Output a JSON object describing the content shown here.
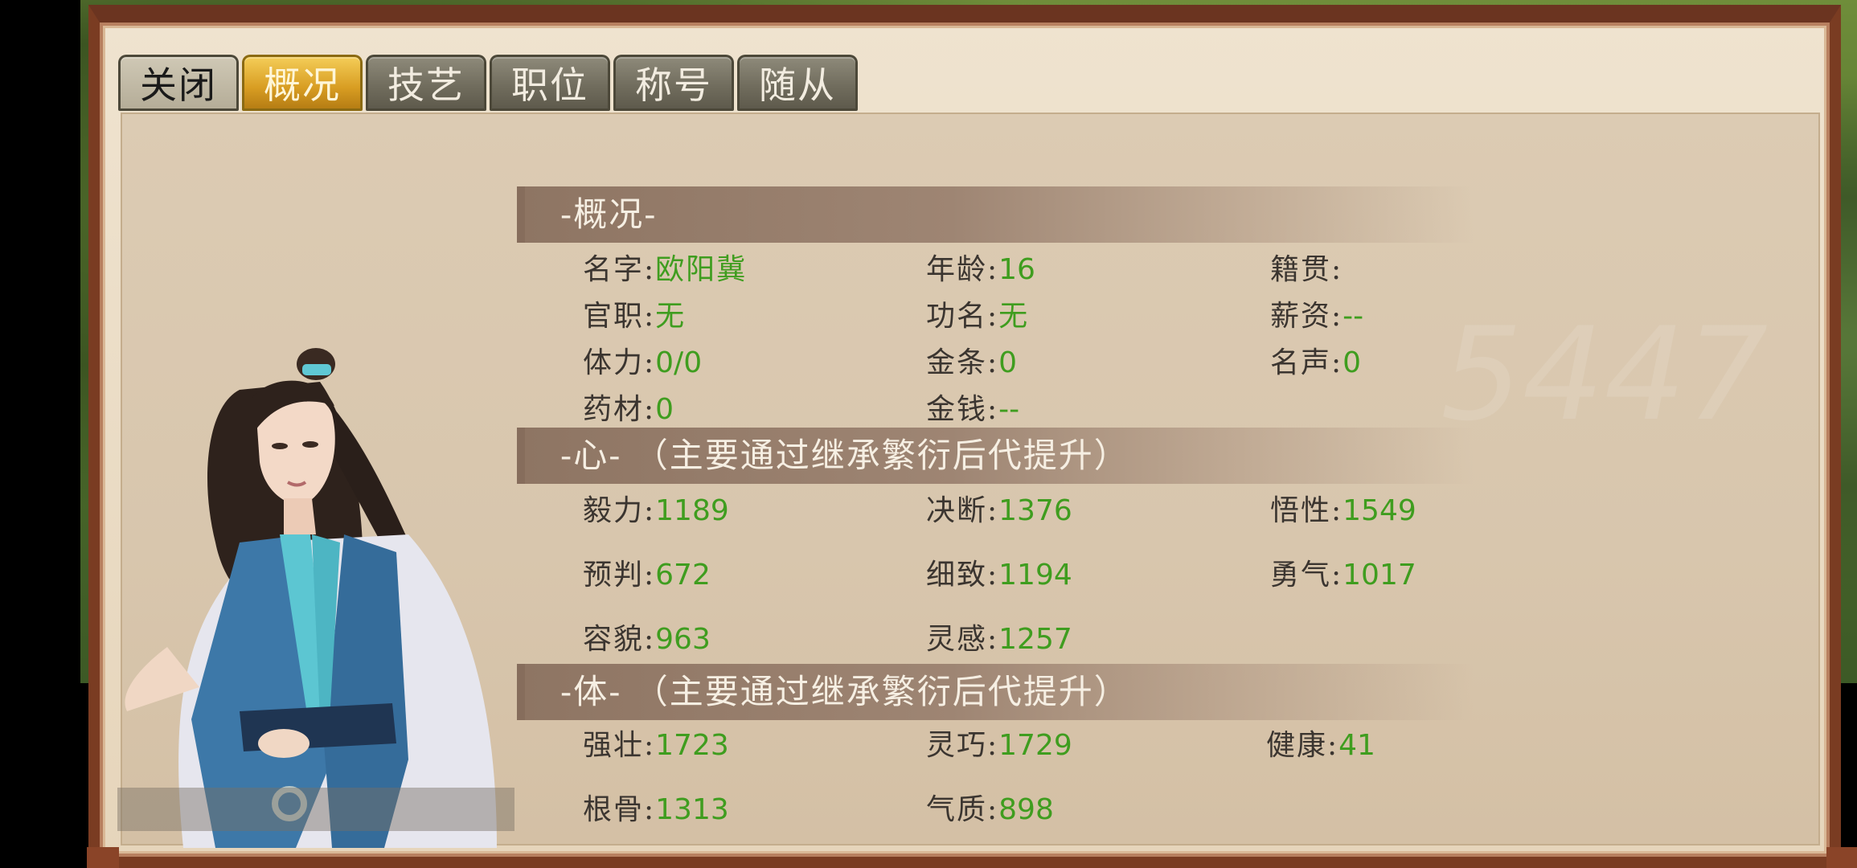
{
  "tabs": [
    "关闭",
    "概况",
    "技艺",
    "职位",
    "称号",
    "随从"
  ],
  "active_tab": "概况",
  "watermark": "5447",
  "sections": {
    "overview": {
      "title": "-概况-",
      "name_label": "名字",
      "name_value": "欧阳冀",
      "age_label": "年龄",
      "age_value": "16",
      "origin_label": "籍贯",
      "origin_value": "",
      "office_label": "官职",
      "office_value": "无",
      "rank_label": "功名",
      "rank_value": "无",
      "salary_label": "薪资",
      "salary_value": "--",
      "stamina_label": "体力",
      "stamina_value": "0/0",
      "gold_bar_label": "金条",
      "gold_bar_value": "0",
      "fame_label": "名声",
      "fame_value": "0",
      "herb_label": "药材",
      "herb_value": "0",
      "money_label": "金钱",
      "money_value": "--"
    },
    "mind": {
      "title": "-心-  （主要通过继承繁衍后代提升）",
      "yili_label": "毅力",
      "yili_value": "1189",
      "jueduan_label": "决断",
      "jueduan_value": "1376",
      "wuxing_label": "悟性",
      "wuxing_value": "1549",
      "yupan_label": "预判",
      "yupan_value": "672",
      "xizhi_label": "细致",
      "xizhi_value": "1194",
      "yongqi_label": "勇气",
      "yongqi_value": "1017",
      "rongmao_label": "容貌",
      "rongmao_value": "963",
      "linggan_label": "灵感",
      "linggan_value": "1257"
    },
    "body": {
      "title": "-体-  （主要通过继承繁衍后代提升）",
      "qiangzhuang_label": "强壮",
      "qiangzhuang_value": "1723",
      "lingqiao_label": "灵巧",
      "lingqiao_value": "1729",
      "jiankang_label": "健康",
      "jiankang_value": "41",
      "gengu_label": "根骨",
      "gengu_value": "1313",
      "qizhi_label": "气质",
      "qizhi_value": "898"
    }
  },
  "colors": {
    "value_green": "#3f9d1f",
    "active_tab_gold": "#e0a52a",
    "frame": "#7a3c22"
  }
}
